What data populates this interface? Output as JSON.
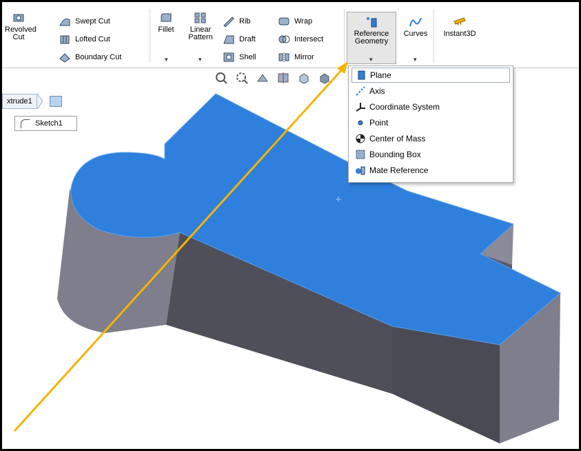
{
  "ribbon": {
    "revolved_cut": "Revolved\nCut",
    "swept_cut": "Swept Cut",
    "lofted_cut": "Lofted Cut",
    "boundary_cut": "Boundary Cut",
    "fillet": "Fillet",
    "linear_pattern": "Linear\nPattern",
    "rib": "Rib",
    "draft": "Draft",
    "shell": "Shell",
    "wrap": "Wrap",
    "intersect": "Intersect",
    "mirror": "Mirror",
    "reference_geometry": "Reference\nGeometry",
    "curves": "Curves",
    "instant3d": "Instant3D"
  },
  "tree": {
    "feature_crumb": "xtrude1",
    "sketch": "Sketch1"
  },
  "menu": {
    "items": [
      {
        "label": "Plane",
        "icon": "plane-icon"
      },
      {
        "label": "Axis",
        "icon": "axis-icon"
      },
      {
        "label": "Coordinate System",
        "icon": "coordinate-system-icon"
      },
      {
        "label": "Point",
        "icon": "point-icon"
      },
      {
        "label": "Center of Mass",
        "icon": "center-of-mass-icon"
      },
      {
        "label": "Bounding Box",
        "icon": "bounding-box-icon"
      },
      {
        "label": "Mate Reference",
        "icon": "mate-reference-icon"
      }
    ]
  },
  "colors": {
    "top_face": "#2f7fdc",
    "side_dark": "#4c4c58",
    "side_light": "#8a8a98",
    "arrow": "#f5b400"
  }
}
